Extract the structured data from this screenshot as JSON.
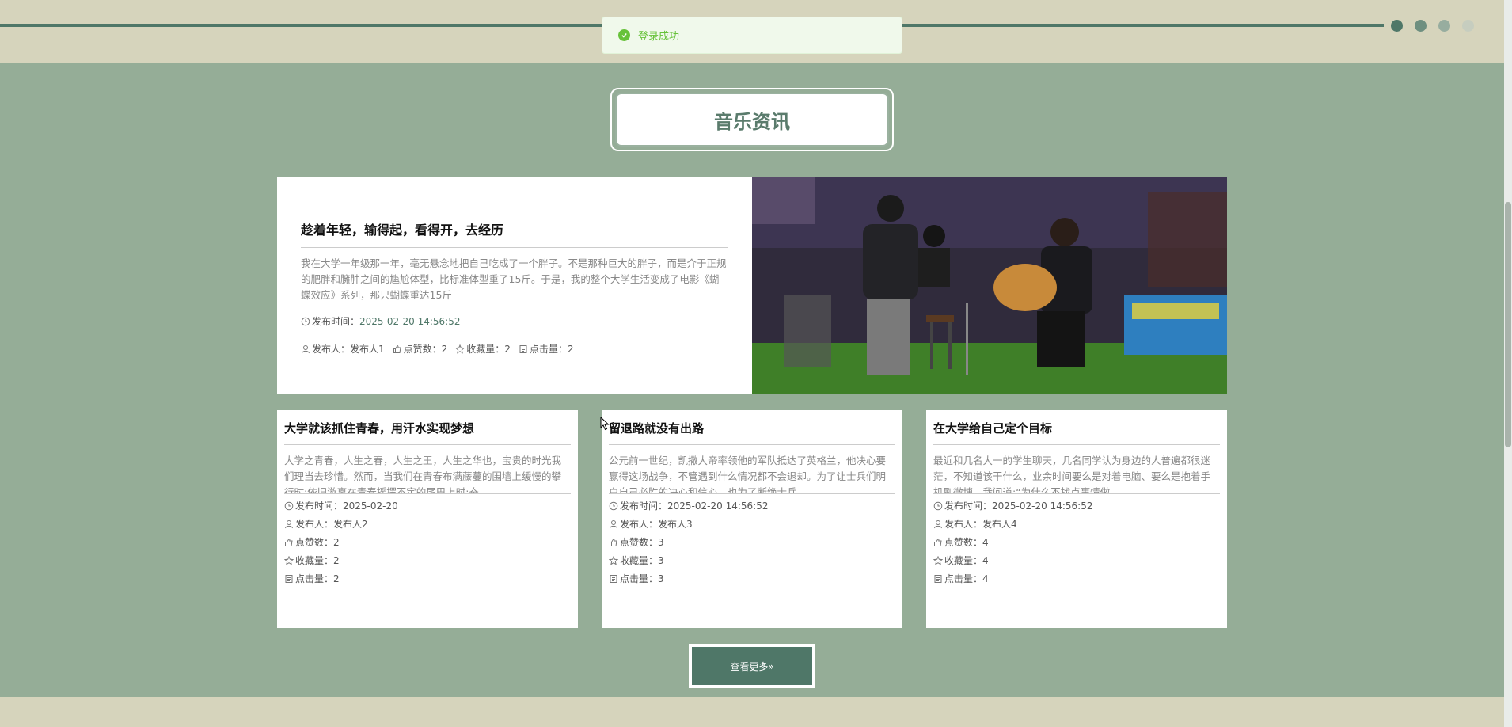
{
  "toast": {
    "message": "登录成功"
  },
  "carousel": {
    "dot_colors": [
      "#4f7768",
      "#6e8f80",
      "#97ad9f",
      "#c6cdbf"
    ]
  },
  "section": {
    "title": "音乐资讯"
  },
  "featured": {
    "title": "趁着年轻，输得起，看得开，去经历",
    "description": "我在大学一年级那一年，毫无悬念地把自己吃成了一个胖子。不是那种巨大的胖子，而是介于正规的肥胖和臃肿之间的尴尬体型，比标准体型重了15斤。于是，我的整个大学生活变成了电影《蝴蝶效应》系列，那只蝴蝶重达15斤",
    "time_label": "发布时间：",
    "time_value": "2025-02-20 14:56:52",
    "author": "发布人：发布人1",
    "likes": "点赞数：2",
    "favorites": "收藏量：2",
    "clicks": "点击量：2"
  },
  "cards": [
    {
      "title": "大学就该抓住青春，用汗水实现梦想",
      "description": "大学之青春，人生之春，人生之王，人生之华也，宝贵的时光我们理当去珍惜。然而，当我们在青春布满藤蔓的围墙上缓慢的攀行时;依旧游离在青春摇摆不定的尾巴上时;奋",
      "time_label": "发布时间：",
      "time_value": "2025-02-20",
      "author": "发布人：发布人2",
      "likes": "点赞数：2",
      "favorites": "收藏量：2",
      "clicks": "点击量：2"
    },
    {
      "title": "留退路就没有出路",
      "description": "公元前一世纪，凯撒大帝率领他的军队抵达了英格兰，他决心要赢得这场战争，不管遇到什么情况都不会退却。为了让士兵们明白自己必胜的决心和信心，也为了断绝士兵",
      "time_label": "发布时间：",
      "time_value": "2025-02-20 14:56:52",
      "author": "发布人：发布人3",
      "likes": "点赞数：3",
      "favorites": "收藏量：3",
      "clicks": "点击量：3"
    },
    {
      "title": "在大学给自己定个目标",
      "description": "最近和几名大一的学生聊天，几名同学认为身边的人普遍都很迷茫，不知道该干什么，业余时间要么是对着电脑、要么是抱着手机刷微博。我问道:“为什么不找点事情做",
      "time_label": "发布时间：",
      "time_value": "2025-02-20 14:56:52",
      "author": "发布人：发布人4",
      "likes": "点赞数：4",
      "favorites": "收藏量：4",
      "clicks": "点击量：4"
    }
  ],
  "more_button": {
    "label": "查看更多»"
  },
  "icons": {
    "clock": "clock-icon",
    "user": "user-icon",
    "thumb": "thumbs-up-icon",
    "star": "star-icon",
    "clicks": "document-icon",
    "check": "check-circle-icon"
  }
}
